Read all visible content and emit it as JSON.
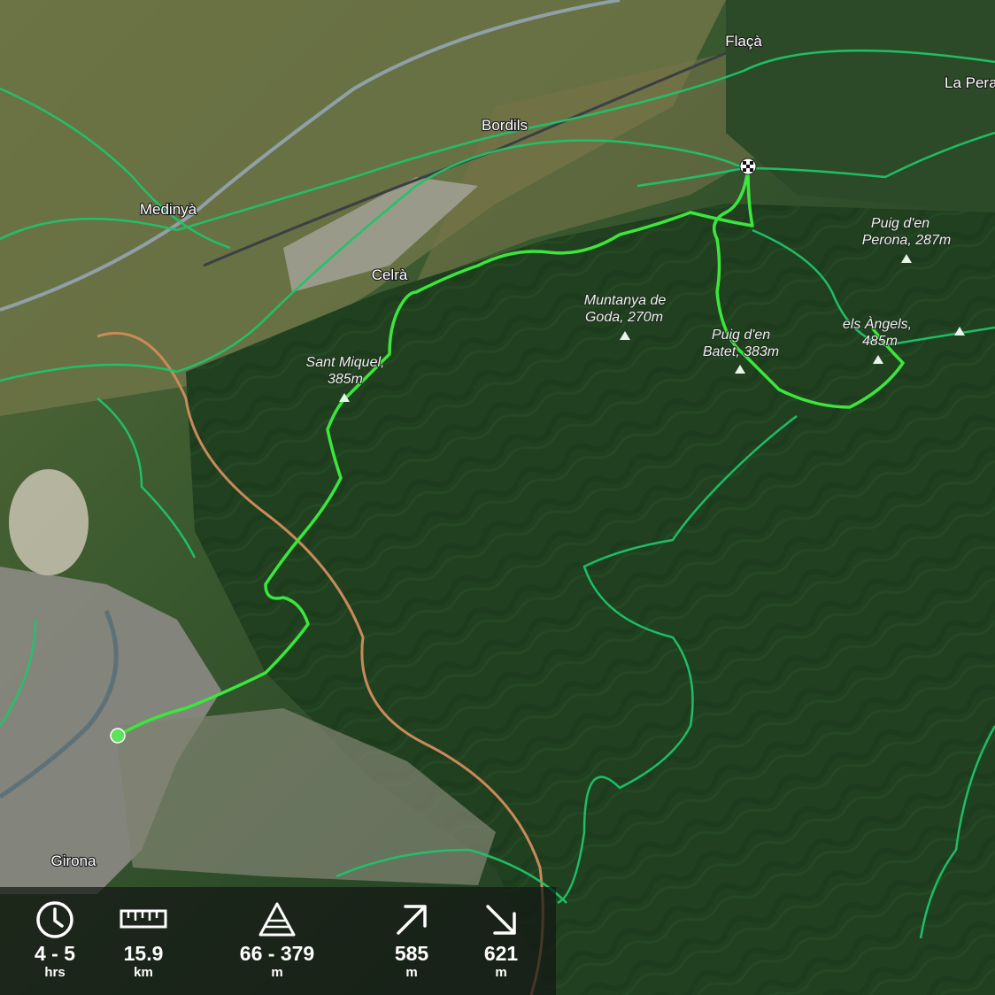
{
  "map": {
    "places": [
      {
        "name": "Flaçà"
      },
      {
        "name": "La Pera"
      },
      {
        "name": "Bordils"
      },
      {
        "name": "Medinyà"
      },
      {
        "name": "Celrà"
      },
      {
        "name": "Girona"
      }
    ],
    "peaks": [
      {
        "name": "Puig d'en",
        "elev": "Perona, 287m"
      },
      {
        "name": "Muntanya de",
        "elev": "Goda, 270m"
      },
      {
        "name": "Puig d'en",
        "elev": "Batet, 383m"
      },
      {
        "name": "els Àngels,",
        "elev": "485m"
      },
      {
        "name": "Sant Miquel,",
        "elev": "385m"
      }
    ],
    "route": {
      "start_marker": "start-point",
      "end_marker": "finish-flag",
      "color": "#3ce63c"
    },
    "trail_color": "#1fc46a",
    "road_color": "#c98a5a"
  },
  "stats": {
    "duration": {
      "icon": "clock-icon",
      "value": "4 - 5",
      "unit": "hrs"
    },
    "distance": {
      "icon": "ruler-icon",
      "value": "15.9",
      "unit": "km"
    },
    "elevation": {
      "icon": "mountain-icon",
      "value": "66 - 379",
      "unit": "m"
    },
    "ascent": {
      "icon": "arrow-up-right-icon",
      "value": "585",
      "unit": "m"
    },
    "descent": {
      "icon": "arrow-down-right-icon",
      "value": "621",
      "unit": "m"
    }
  }
}
